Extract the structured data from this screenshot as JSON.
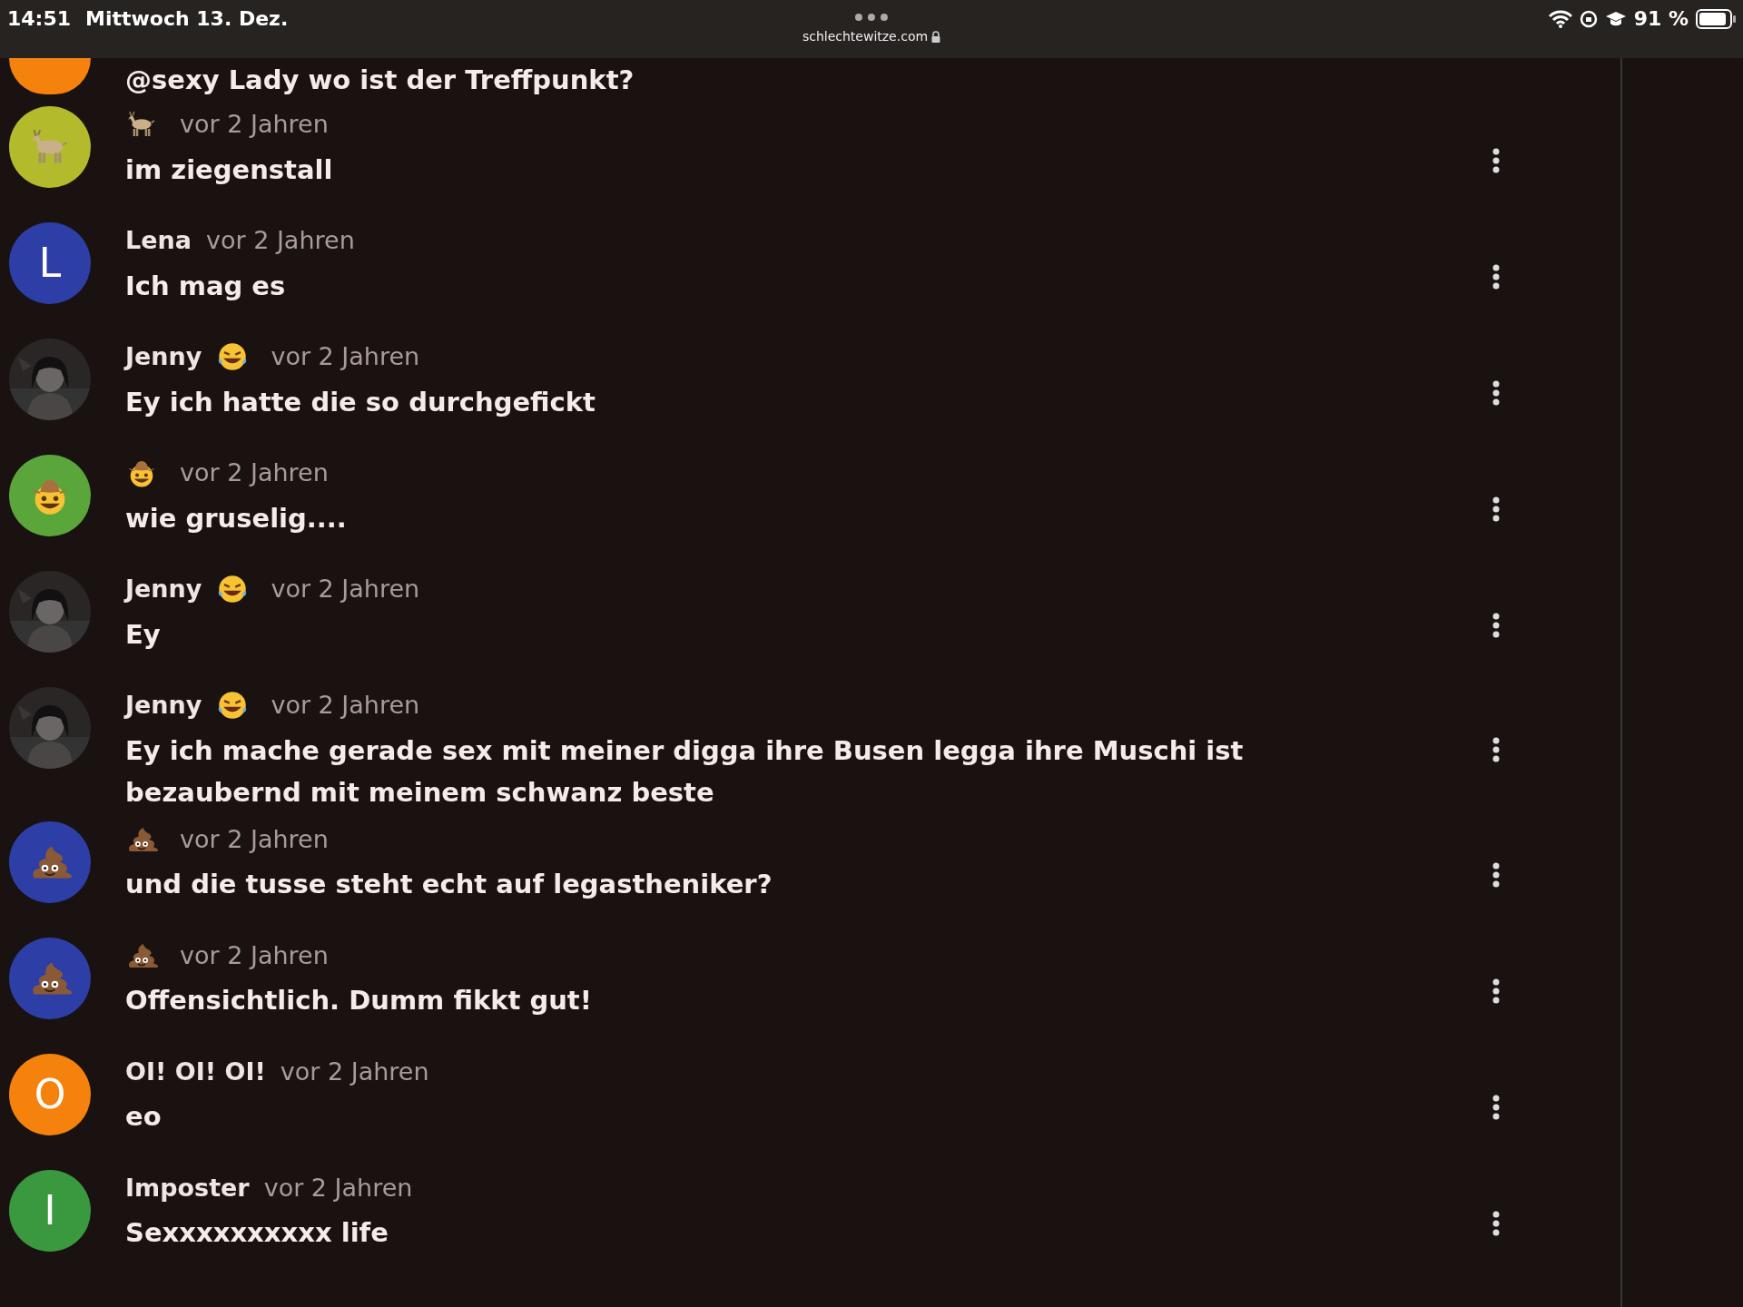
{
  "status_bar": {
    "time": "14:51",
    "date": "Mittwoch 13. Dez.",
    "url": "schlechtewitze.com",
    "battery": "91 %"
  },
  "partial_comment": {
    "text": "@sexy Lady wo ist der Treffpunkt?"
  },
  "comments": [
    {
      "kind": "goat",
      "avatar": {
        "color": "#b3bb2c"
      },
      "time": "vor 2 Jahren",
      "text": "im ziegenstall"
    },
    {
      "kind": "letter",
      "avatar": {
        "letter": "L",
        "color": "#2d3ea6"
      },
      "author": "Lena",
      "time": "vor 2 Jahren",
      "text": "Ich mag es"
    },
    {
      "kind": "laugh",
      "author": "Jenny",
      "time": "vor 2 Jahren",
      "text": "Ey ich hatte die so durchgefickt"
    },
    {
      "kind": "cowboy",
      "avatar": {
        "color": "#5ba63b"
      },
      "time": "vor 2 Jahren",
      "text": "wie gruselig...."
    },
    {
      "kind": "laugh",
      "author": "Jenny",
      "time": "vor 2 Jahren",
      "text": "Ey"
    },
    {
      "kind": "laugh",
      "author": "Jenny",
      "time": "vor 2 Jahren",
      "text": "Ey ich mache gerade sex mit meiner digga ihre Busen legga ihre Muschi ist bezaubernd mit meinem schwanz beste"
    },
    {
      "kind": "poop",
      "avatar": {
        "color": "#2d3ea6"
      },
      "time": "vor 2 Jahren",
      "text": "und die tusse steht echt auf legastheniker?"
    },
    {
      "kind": "poop",
      "avatar": {
        "color": "#2d3ea6"
      },
      "time": "vor 2 Jahren",
      "text": "Offensichtlich. Dumm fikkt gut!"
    },
    {
      "kind": "letter",
      "avatar": {
        "letter": "O",
        "color": "#f5820d"
      },
      "author": "OI! OI! OI!",
      "time": "vor 2 Jahren",
      "text": "eo"
    },
    {
      "kind": "letter",
      "avatar": {
        "letter": "I",
        "color": "#3a993e"
      },
      "author": "Imposter",
      "time": "vor 2 Jahren",
      "text": "Sexxxxxxxxxx life"
    }
  ]
}
